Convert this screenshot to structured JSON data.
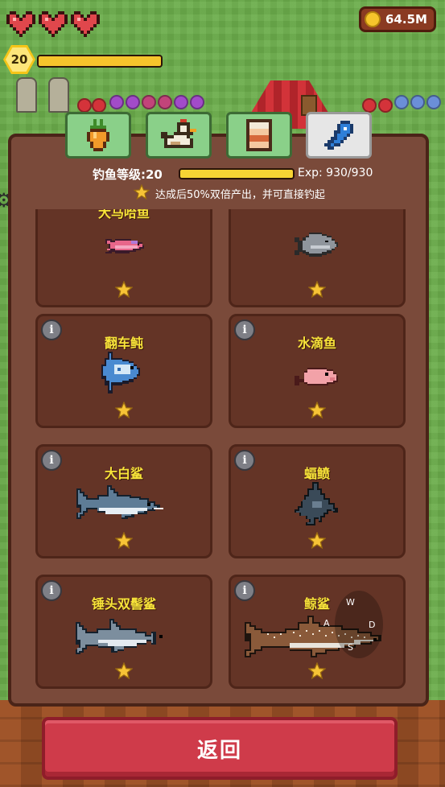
{
  "hud": {
    "hearts": 3,
    "level": "20",
    "level_progress": 1.0,
    "coins": "64.5M"
  },
  "tabs": [
    {
      "icon": "carrot-icon",
      "active": false
    },
    {
      "icon": "chicken-icon",
      "active": false
    },
    {
      "icon": "jar-icon",
      "active": false
    },
    {
      "icon": "fish-icon",
      "active": true
    }
  ],
  "fishing": {
    "level_label": "钓鱼等级:20",
    "exp_text": "Exp: 930/930",
    "exp_progress": 1.0,
    "hint": "达成后50%双倍产出，并可直接钓起"
  },
  "fish_cards": [
    {
      "name": "大马哈鱼",
      "icon": "salmon-icon",
      "stars": 1,
      "info": "i"
    },
    {
      "name": "翻车鲀",
      "icon": "sunfish-icon",
      "stars": 1,
      "info": "i"
    },
    {
      "name": "水滴鱼",
      "icon": "blobfish-icon",
      "stars": 1,
      "info": "i"
    },
    {
      "name": "大白鲨",
      "icon": "great-white-shark-icon",
      "stars": 1,
      "info": "i"
    },
    {
      "name": "蝠鲼",
      "icon": "manta-ray-icon",
      "stars": 1,
      "info": "i"
    },
    {
      "name": "锤头双髻鲨",
      "icon": "hammerhead-shark-icon",
      "stars": 1,
      "info": "i"
    },
    {
      "name": "鲸鲨",
      "icon": "whale-shark-icon",
      "stars": 1,
      "info": "i"
    }
  ],
  "joystick": {
    "up": "W",
    "left": "A",
    "right": "D",
    "down": "S"
  },
  "back_button": "返回"
}
